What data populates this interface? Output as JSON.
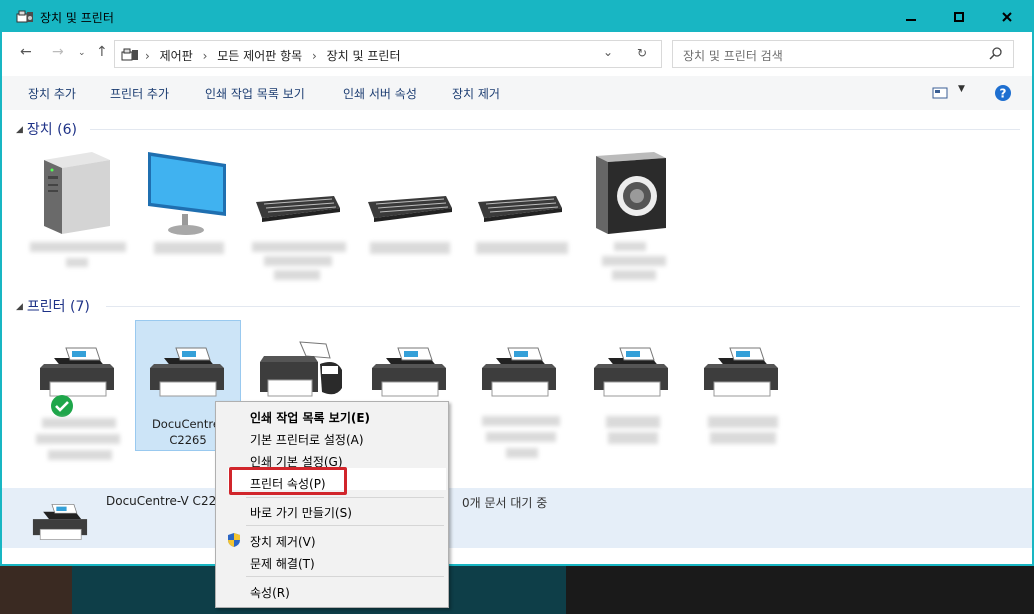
{
  "window": {
    "title": "장치 및 프린터"
  },
  "nav": {
    "breadcrumb": [
      "제어판",
      "모든 제어판 항목",
      "장치 및 프린터"
    ],
    "search_placeholder": "장치 및 프린터 검색"
  },
  "toolbar": {
    "items": [
      "장치 추가",
      "프린터 추가",
      "인쇄 작업 목록 보기",
      "인쇄 서버 속성",
      "장치 제거"
    ]
  },
  "groups": {
    "devices": {
      "label": "장치",
      "count": "(6)"
    },
    "printers": {
      "label": "프린터",
      "count": "(7)"
    }
  },
  "selected_printer": {
    "label_line1": "DocuCentre-",
    "label_line2": "C2265"
  },
  "details": {
    "name": "DocuCentre-V C22",
    "status": "0개 문서 대기 중"
  },
  "context_menu": {
    "items": [
      "인쇄 작업 목록 보기(E)",
      "기본 프린터로 설정(A)",
      "인쇄 기본 설정(G)",
      "프린터 속성(P)",
      "바로 가기 만들기(S)",
      "장치 제거(V)",
      "문제 해결(T)",
      "속성(R)"
    ]
  },
  "colors": {
    "title_bar": "#18b6c3",
    "highlight_box": "#d1252b",
    "selection": "#cce4f7"
  }
}
